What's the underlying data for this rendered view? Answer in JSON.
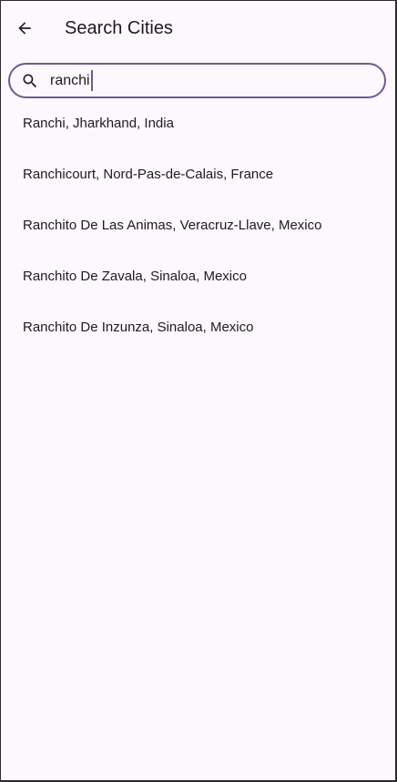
{
  "header": {
    "title": "Search Cities",
    "back_icon": "arrow-left-icon"
  },
  "search": {
    "icon": "search-icon",
    "value": "ranchi",
    "accent_color": "#6d5a94"
  },
  "results": [
    "Ranchi, Jharkhand, India",
    "Ranchicourt, Nord-Pas-de-Calais, France",
    "Ranchito De Las Animas, Veracruz-Llave, Mexico",
    "Ranchito De Zavala, Sinaloa, Mexico",
    "Ranchito De Inzunza, Sinaloa, Mexico"
  ],
  "colors": {
    "background": "#fdf7fe",
    "text": "#1d1b20"
  }
}
